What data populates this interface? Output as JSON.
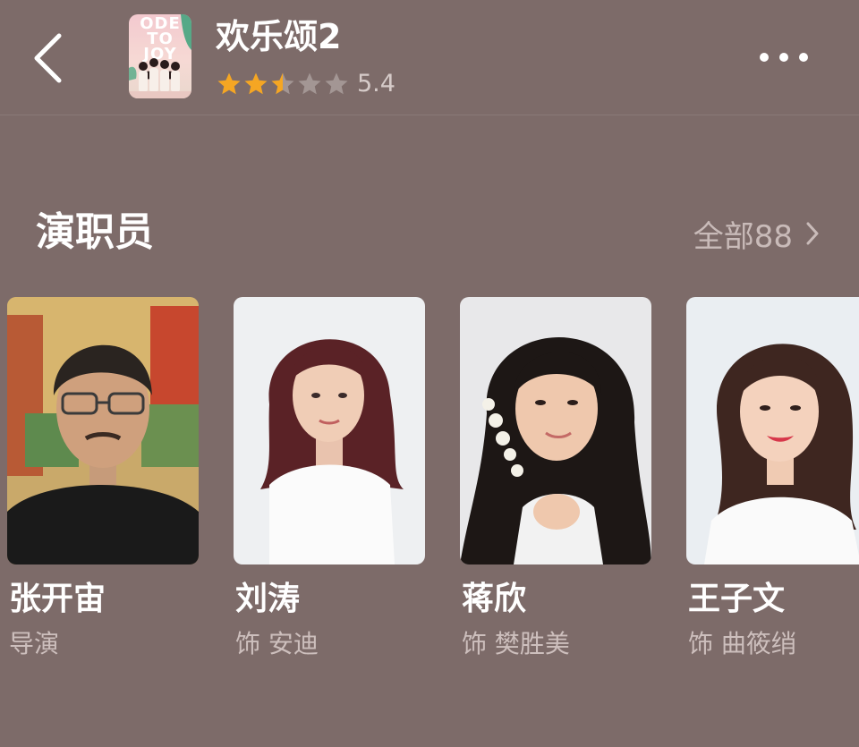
{
  "header": {
    "back_icon": "chevron-left-icon",
    "poster_text": "ODE TO JOY",
    "title": "欢乐颂2",
    "rating": "5.4",
    "stars": 2.5,
    "star_colors": {
      "filled": "#f5a623",
      "empty": "#a39694"
    },
    "more_icon": "more-dots-icon"
  },
  "cast_section": {
    "title": "演职员",
    "all_label": "全部88",
    "chevron_icon": "chevron-right-icon",
    "members": [
      {
        "name": "张开宙",
        "role": "导演"
      },
      {
        "name": "刘涛",
        "role": "饰 安迪"
      },
      {
        "name": "蒋欣",
        "role": "饰 樊胜美"
      },
      {
        "name": "王子文",
        "role": "饰 曲筱绡"
      }
    ]
  }
}
